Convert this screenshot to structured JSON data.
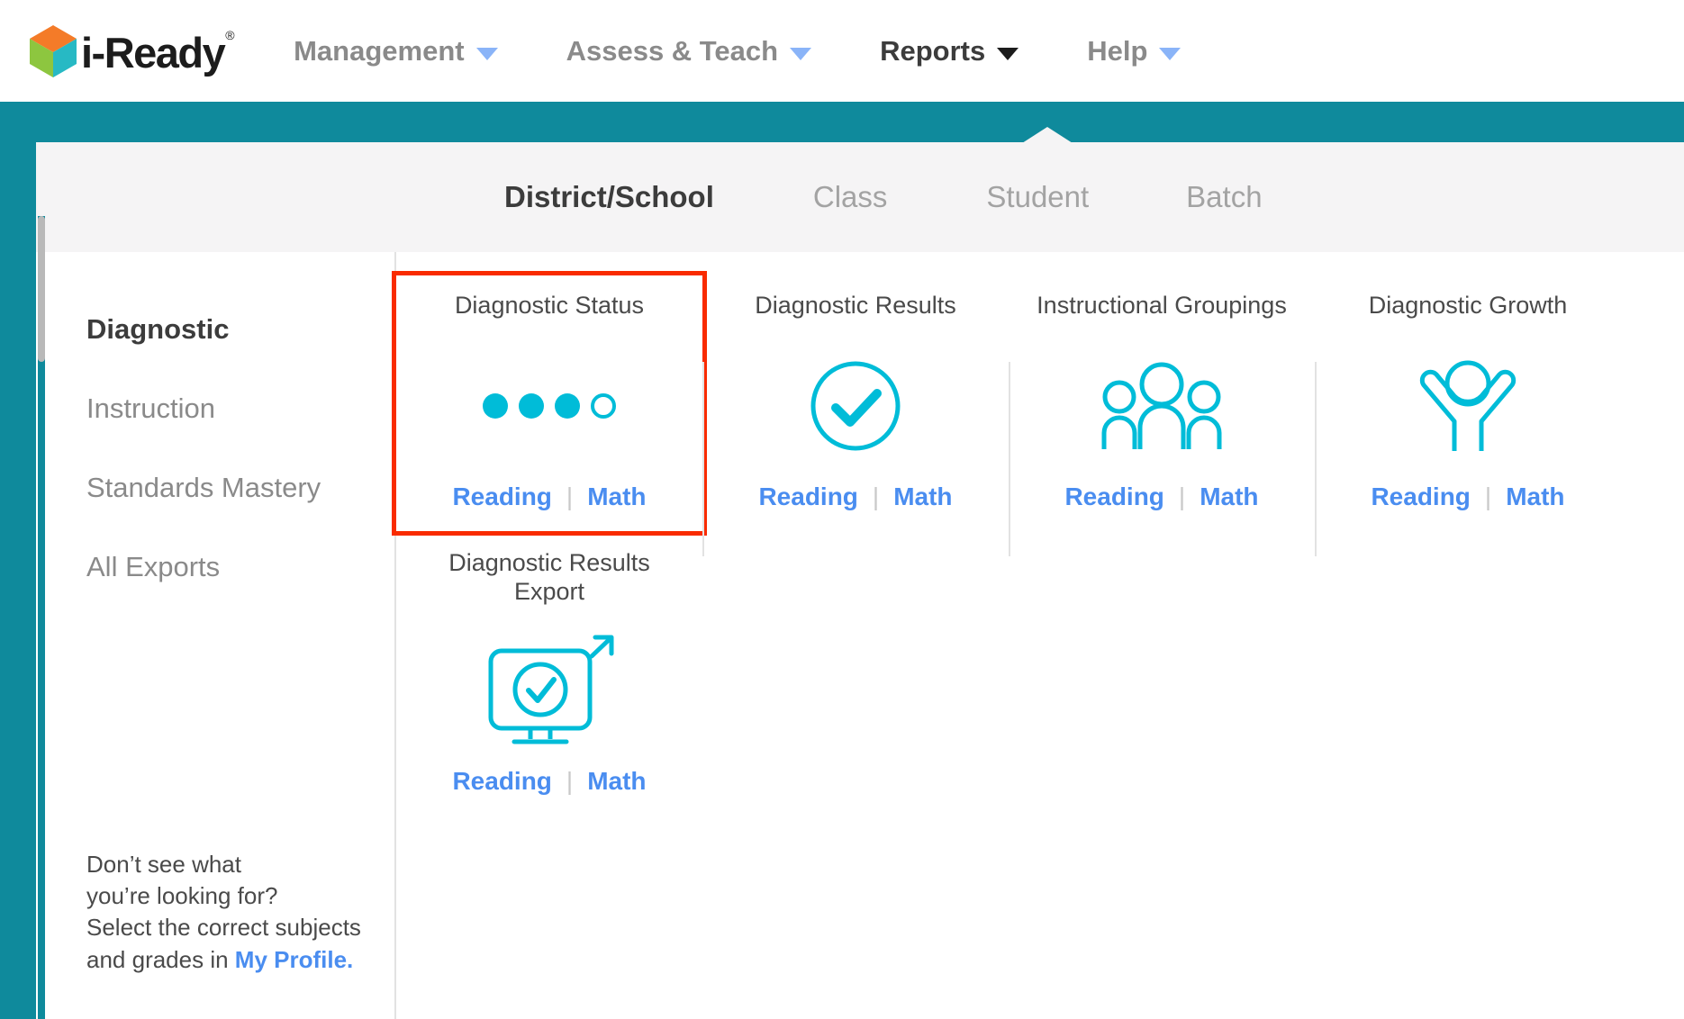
{
  "brand": {
    "name": "i-Ready",
    "registered": "®",
    "cube_colors": {
      "top": "#f47b28",
      "left": "#8dc63f",
      "right": "#27b9c4"
    }
  },
  "colors": {
    "teal_band": "#0f8a9c",
    "icon_cyan": "#00bcd8",
    "link_blue": "#4a8df0",
    "highlight_red": "#f92b00",
    "text_dark": "#3c3c3c",
    "text_muted": "#8a8a8a"
  },
  "topnav": {
    "items": [
      {
        "label": "Management",
        "active": false,
        "icon": "chevron-down-icon"
      },
      {
        "label": "Assess & Teach",
        "active": false,
        "icon": "chevron-down-icon"
      },
      {
        "label": "Reports",
        "active": true,
        "icon": "chevron-down-icon"
      },
      {
        "label": "Help",
        "active": false,
        "icon": "chevron-down-icon"
      }
    ]
  },
  "tabs": [
    {
      "label": "District/School",
      "active": true
    },
    {
      "label": "Class",
      "active": false
    },
    {
      "label": "Student",
      "active": false
    },
    {
      "label": "Batch",
      "active": false
    }
  ],
  "sidebar": {
    "items": [
      {
        "label": "Diagnostic",
        "active": true
      },
      {
        "label": "Instruction",
        "active": false
      },
      {
        "label": "Standards Mastery",
        "active": false
      },
      {
        "label": "All Exports",
        "active": false
      }
    ],
    "help": {
      "line1": "Don’t see what",
      "line2": "you’re looking for?",
      "line3": "Select the correct subjects",
      "line4_prefix": "and grades in ",
      "link": "My Profile."
    }
  },
  "reports": {
    "row1": [
      {
        "title": "Diagnostic Status",
        "icon": "progress-dots-icon",
        "dots_filled": 3,
        "dots_total": 4,
        "highlighted": true,
        "links": {
          "reading": "Reading",
          "separator": "|",
          "math": "Math"
        }
      },
      {
        "title": "Diagnostic Results",
        "icon": "check-circle-icon",
        "highlighted": false,
        "links": {
          "reading": "Reading",
          "separator": "|",
          "math": "Math"
        }
      },
      {
        "title": "Instructional Groupings",
        "icon": "three-people-icon",
        "highlighted": false,
        "links": {
          "reading": "Reading",
          "separator": "|",
          "math": "Math"
        }
      },
      {
        "title": "Diagnostic Growth",
        "icon": "person-arms-raised-icon",
        "highlighted": false,
        "links": {
          "reading": "Reading",
          "separator": "|",
          "math": "Math"
        }
      }
    ],
    "row2": [
      {
        "title": "Diagnostic Results\nExport",
        "icon": "monitor-export-icon",
        "highlighted": false,
        "links": {
          "reading": "Reading",
          "separator": "|",
          "math": "Math"
        }
      }
    ]
  },
  "scrollbar": {
    "orientation": "vertical",
    "position": "left"
  }
}
